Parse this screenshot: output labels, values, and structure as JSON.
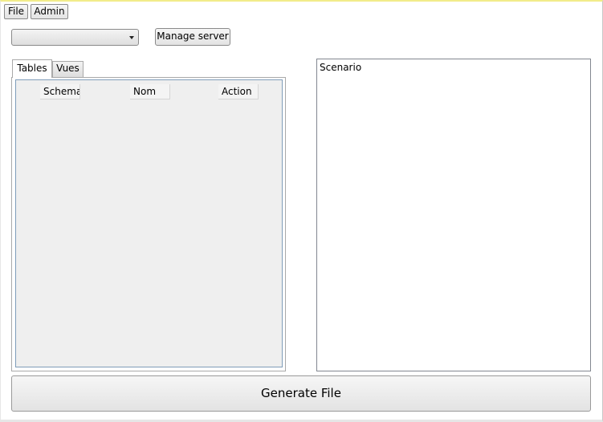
{
  "menu": {
    "file_label": "File",
    "admin_label": "Admin"
  },
  "server": {
    "selected_value": "",
    "manage_label": "Manage server"
  },
  "tabs": [
    {
      "label": "Tables",
      "active": true
    },
    {
      "label": "Vues",
      "active": false
    }
  ],
  "grid": {
    "columns": [
      "Schema",
      "Nom",
      "Action"
    ],
    "rows": []
  },
  "scenario": {
    "text": "Scenario"
  },
  "actions": {
    "generate_label": "Generate File"
  }
}
